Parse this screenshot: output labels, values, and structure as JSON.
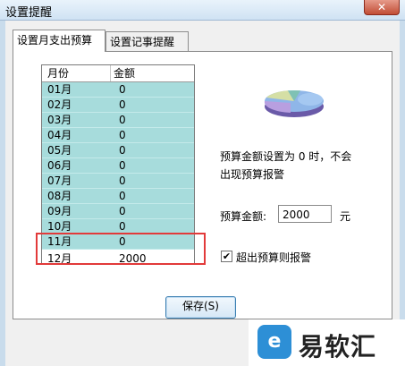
{
  "window": {
    "title": "设置提醒",
    "close_label": "✕"
  },
  "tabs": [
    {
      "label": "设置月支出预算"
    },
    {
      "label": "设置记事提醒"
    }
  ],
  "table": {
    "headers": [
      "月份",
      "金额"
    ],
    "rows": [
      {
        "month": "01月",
        "amount": "0"
      },
      {
        "month": "02月",
        "amount": "0"
      },
      {
        "month": "03月",
        "amount": "0"
      },
      {
        "month": "04月",
        "amount": "0"
      },
      {
        "month": "05月",
        "amount": "0"
      },
      {
        "month": "06月",
        "amount": "0"
      },
      {
        "month": "07月",
        "amount": "0"
      },
      {
        "month": "08月",
        "amount": "0"
      },
      {
        "month": "09月",
        "amount": "0"
      },
      {
        "month": "10月",
        "amount": "0"
      },
      {
        "month": "11月",
        "amount": "0"
      },
      {
        "month": "12月",
        "amount": "2000"
      }
    ],
    "selected_row": "12月"
  },
  "settings": {
    "hint_line1": "预算金额设置为 0 时，不会",
    "hint_line2": "出现预算报警",
    "budget_label": "预算金额:",
    "budget_value": "2000",
    "budget_unit": "元",
    "checkbox_label": "超出预算则报警",
    "checkbox_checked": true,
    "checkbox_mark": "✔"
  },
  "save_button": {
    "label": "保存(S)"
  },
  "watermark": {
    "logo_glyph": "e",
    "text": "易软汇"
  },
  "colors": {
    "row_bg": "#a7dcdc",
    "highlight": "#e23a3a",
    "titlebar": "#cfe2f3"
  }
}
